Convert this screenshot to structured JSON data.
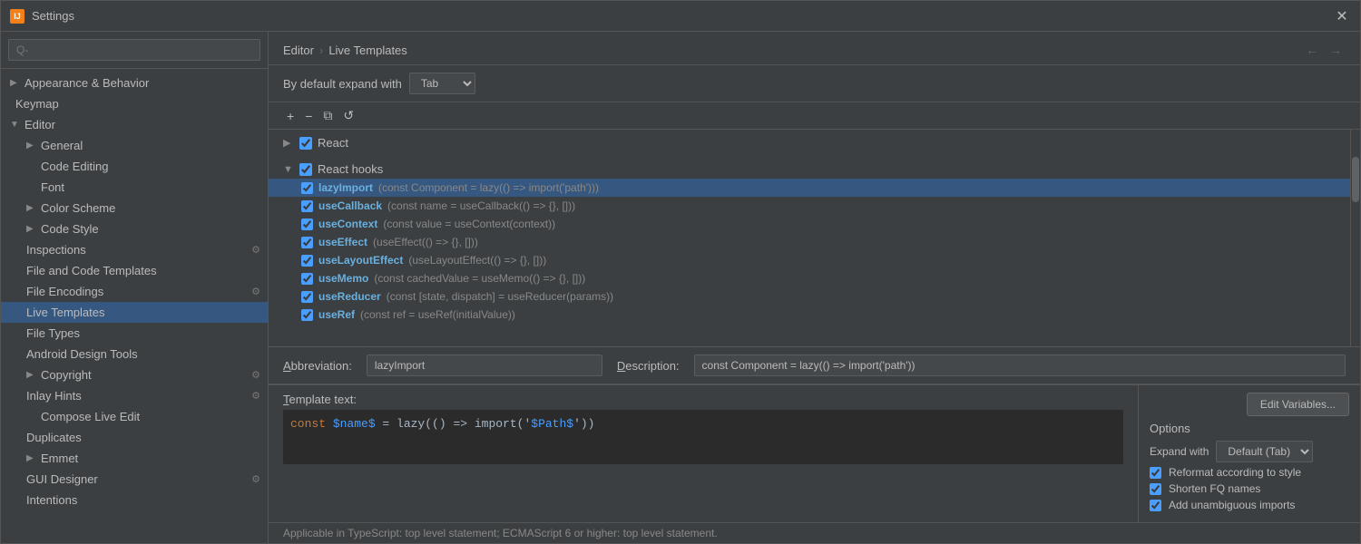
{
  "window": {
    "title": "Settings",
    "icon": "IJ"
  },
  "sidebar": {
    "search_placeholder": "Q-",
    "items": [
      {
        "id": "appearance",
        "label": "Appearance & Behavior",
        "indent": 0,
        "chevron": "▶",
        "expanded": false
      },
      {
        "id": "keymap",
        "label": "Keymap",
        "indent": 0,
        "chevron": "",
        "expanded": false
      },
      {
        "id": "editor",
        "label": "Editor",
        "indent": 0,
        "chevron": "▼",
        "expanded": true
      },
      {
        "id": "general",
        "label": "General",
        "indent": 1,
        "chevron": "▶",
        "expanded": false
      },
      {
        "id": "code-editing",
        "label": "Code Editing",
        "indent": 2,
        "chevron": ""
      },
      {
        "id": "font",
        "label": "Font",
        "indent": 2,
        "chevron": ""
      },
      {
        "id": "color-scheme",
        "label": "Color Scheme",
        "indent": 1,
        "chevron": "▶"
      },
      {
        "id": "code-style",
        "label": "Code Style",
        "indent": 1,
        "chevron": "▶"
      },
      {
        "id": "inspections",
        "label": "Inspections",
        "indent": 1,
        "chevron": "",
        "has-icon": true
      },
      {
        "id": "file-code-templates",
        "label": "File and Code Templates",
        "indent": 1,
        "chevron": ""
      },
      {
        "id": "file-encodings",
        "label": "File Encodings",
        "indent": 1,
        "chevron": "",
        "has-icon": true
      },
      {
        "id": "live-templates",
        "label": "Live Templates",
        "indent": 1,
        "chevron": "",
        "selected": true
      },
      {
        "id": "file-types",
        "label": "File Types",
        "indent": 1,
        "chevron": ""
      },
      {
        "id": "android-design-tools",
        "label": "Android Design Tools",
        "indent": 1,
        "chevron": ""
      },
      {
        "id": "copyright",
        "label": "Copyright",
        "indent": 1,
        "chevron": "▶",
        "has-icon": true
      },
      {
        "id": "inlay-hints",
        "label": "Inlay Hints",
        "indent": 1,
        "chevron": "",
        "has-icon": true
      },
      {
        "id": "compose-live-edit",
        "label": "Compose Live Edit",
        "indent": 2,
        "chevron": ""
      },
      {
        "id": "duplicates",
        "label": "Duplicates",
        "indent": 1,
        "chevron": ""
      },
      {
        "id": "emmet",
        "label": "Emmet",
        "indent": 1,
        "chevron": "▶"
      },
      {
        "id": "gui-designer",
        "label": "GUI Designer",
        "indent": 1,
        "chevron": "",
        "has-icon": true
      },
      {
        "id": "intentions",
        "label": "Intentions",
        "indent": 1,
        "chevron": ""
      }
    ]
  },
  "header": {
    "breadcrumb_parent": "Editor",
    "breadcrumb_sep": "›",
    "breadcrumb_current": "Live Templates"
  },
  "expand_bar": {
    "label": "By default expand with",
    "select_value": "Tab"
  },
  "toolbar": {
    "add_label": "+",
    "remove_label": "−",
    "copy_label": "⧉",
    "reset_label": "↺"
  },
  "template_groups": [
    {
      "id": "react",
      "label": "React",
      "checked": true,
      "expanded": false
    },
    {
      "id": "react-hooks",
      "label": "React hooks",
      "checked": true,
      "expanded": true,
      "items": [
        {
          "name": "lazyImport",
          "desc": "(const Component = lazy(() => import('path')))",
          "checked": true,
          "selected": true
        },
        {
          "name": "useCallback",
          "desc": "(const name = useCallback(() => {}, []))",
          "checked": true
        },
        {
          "name": "useContext",
          "desc": "(const value = useContext(context))",
          "checked": true
        },
        {
          "name": "useEffect",
          "desc": "(useEffect(() => {}, []))",
          "checked": true
        },
        {
          "name": "useLayoutEffect",
          "desc": "(useLayoutEffect(() => {}, []))",
          "checked": true
        },
        {
          "name": "useMemo",
          "desc": "(const cachedValue = useMemo(() => {}, []))",
          "checked": true
        },
        {
          "name": "useReducer",
          "desc": "(const [state, dispatch] = useReducer(params))",
          "checked": true
        },
        {
          "name": "useRef",
          "desc": "(const ref = useRef(initialValue))",
          "checked": true
        }
      ]
    }
  ],
  "bottom_panel": {
    "abbreviation_label": "Abbreviation:",
    "abbreviation_value": "lazyImport",
    "description_label": "Description:",
    "description_value": "const Component = lazy(() => import('path'))",
    "template_text_label": "Template text:",
    "template_code": "const $name$ = lazy(() => import('$Path$'))",
    "edit_vars_button": "Edit Variables...",
    "applicable_text": "Applicable in TypeScript: top level statement; ECMAScript 6 or higher: top level statement."
  },
  "options": {
    "title": "Options",
    "expand_label": "Expand with",
    "expand_value": "Default (Tab)",
    "checkboxes": [
      {
        "label": "Reformat according to style",
        "checked": true
      },
      {
        "label": "Shorten FQ names",
        "checked": true
      },
      {
        "label": "Add unambiguous imports",
        "checked": true
      }
    ]
  }
}
